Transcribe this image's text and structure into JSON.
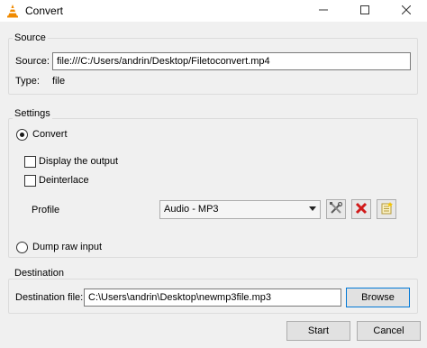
{
  "window": {
    "title": "Convert",
    "minimize_icon": "minimize-icon",
    "maximize_icon": "maximize-icon",
    "close_icon": "close-icon"
  },
  "source": {
    "group_label": "Source",
    "source_label": "Source:",
    "source_value": "file:///C:/Users/andrin/Desktop/Filetoconvert.mp4",
    "type_label": "Type:",
    "type_value": "file"
  },
  "settings": {
    "group_label": "Settings",
    "convert_label": "Convert",
    "convert_selected": true,
    "display_output_label": "Display the output",
    "display_output_checked": false,
    "deinterlace_label": "Deinterlace",
    "deinterlace_checked": false,
    "profile_label": "Profile",
    "profile_value": "Audio - MP3",
    "dump_raw_label": "Dump raw input",
    "dump_raw_selected": false
  },
  "destination": {
    "group_label": "Destination",
    "file_label": "Destination file:",
    "file_value": "C:\\Users\\andrin\\Desktop\\newmp3file.mp3",
    "browse_label": "Browse"
  },
  "footer": {
    "start_label": "Start",
    "cancel_label": "Cancel"
  },
  "colors": {
    "delete_red": "#d11a1a",
    "vlc_orange": "#f08a00"
  }
}
